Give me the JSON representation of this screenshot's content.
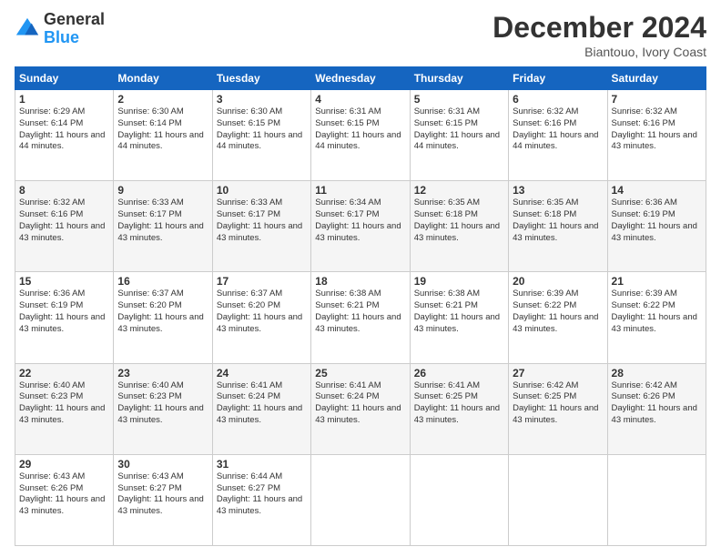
{
  "header": {
    "logo_general": "General",
    "logo_blue": "Blue",
    "title": "December 2024",
    "subtitle": "Biantouo, Ivory Coast"
  },
  "days_of_week": [
    "Sunday",
    "Monday",
    "Tuesday",
    "Wednesday",
    "Thursday",
    "Friday",
    "Saturday"
  ],
  "weeks": [
    [
      {
        "day": "1",
        "sunrise": "6:29 AM",
        "sunset": "6:14 PM",
        "daylight": "11 hours and 44 minutes."
      },
      {
        "day": "2",
        "sunrise": "6:30 AM",
        "sunset": "6:14 PM",
        "daylight": "11 hours and 44 minutes."
      },
      {
        "day": "3",
        "sunrise": "6:30 AM",
        "sunset": "6:15 PM",
        "daylight": "11 hours and 44 minutes."
      },
      {
        "day": "4",
        "sunrise": "6:31 AM",
        "sunset": "6:15 PM",
        "daylight": "11 hours and 44 minutes."
      },
      {
        "day": "5",
        "sunrise": "6:31 AM",
        "sunset": "6:15 PM",
        "daylight": "11 hours and 44 minutes."
      },
      {
        "day": "6",
        "sunrise": "6:32 AM",
        "sunset": "6:16 PM",
        "daylight": "11 hours and 44 minutes."
      },
      {
        "day": "7",
        "sunrise": "6:32 AM",
        "sunset": "6:16 PM",
        "daylight": "11 hours and 43 minutes."
      }
    ],
    [
      {
        "day": "8",
        "sunrise": "6:32 AM",
        "sunset": "6:16 PM",
        "daylight": "11 hours and 43 minutes."
      },
      {
        "day": "9",
        "sunrise": "6:33 AM",
        "sunset": "6:17 PM",
        "daylight": "11 hours and 43 minutes."
      },
      {
        "day": "10",
        "sunrise": "6:33 AM",
        "sunset": "6:17 PM",
        "daylight": "11 hours and 43 minutes."
      },
      {
        "day": "11",
        "sunrise": "6:34 AM",
        "sunset": "6:17 PM",
        "daylight": "11 hours and 43 minutes."
      },
      {
        "day": "12",
        "sunrise": "6:35 AM",
        "sunset": "6:18 PM",
        "daylight": "11 hours and 43 minutes."
      },
      {
        "day": "13",
        "sunrise": "6:35 AM",
        "sunset": "6:18 PM",
        "daylight": "11 hours and 43 minutes."
      },
      {
        "day": "14",
        "sunrise": "6:36 AM",
        "sunset": "6:19 PM",
        "daylight": "11 hours and 43 minutes."
      }
    ],
    [
      {
        "day": "15",
        "sunrise": "6:36 AM",
        "sunset": "6:19 PM",
        "daylight": "11 hours and 43 minutes."
      },
      {
        "day": "16",
        "sunrise": "6:37 AM",
        "sunset": "6:20 PM",
        "daylight": "11 hours and 43 minutes."
      },
      {
        "day": "17",
        "sunrise": "6:37 AM",
        "sunset": "6:20 PM",
        "daylight": "11 hours and 43 minutes."
      },
      {
        "day": "18",
        "sunrise": "6:38 AM",
        "sunset": "6:21 PM",
        "daylight": "11 hours and 43 minutes."
      },
      {
        "day": "19",
        "sunrise": "6:38 AM",
        "sunset": "6:21 PM",
        "daylight": "11 hours and 43 minutes."
      },
      {
        "day": "20",
        "sunrise": "6:39 AM",
        "sunset": "6:22 PM",
        "daylight": "11 hours and 43 minutes."
      },
      {
        "day": "21",
        "sunrise": "6:39 AM",
        "sunset": "6:22 PM",
        "daylight": "11 hours and 43 minutes."
      }
    ],
    [
      {
        "day": "22",
        "sunrise": "6:40 AM",
        "sunset": "6:23 PM",
        "daylight": "11 hours and 43 minutes."
      },
      {
        "day": "23",
        "sunrise": "6:40 AM",
        "sunset": "6:23 PM",
        "daylight": "11 hours and 43 minutes."
      },
      {
        "day": "24",
        "sunrise": "6:41 AM",
        "sunset": "6:24 PM",
        "daylight": "11 hours and 43 minutes."
      },
      {
        "day": "25",
        "sunrise": "6:41 AM",
        "sunset": "6:24 PM",
        "daylight": "11 hours and 43 minutes."
      },
      {
        "day": "26",
        "sunrise": "6:41 AM",
        "sunset": "6:25 PM",
        "daylight": "11 hours and 43 minutes."
      },
      {
        "day": "27",
        "sunrise": "6:42 AM",
        "sunset": "6:25 PM",
        "daylight": "11 hours and 43 minutes."
      },
      {
        "day": "28",
        "sunrise": "6:42 AM",
        "sunset": "6:26 PM",
        "daylight": "11 hours and 43 minutes."
      }
    ],
    [
      {
        "day": "29",
        "sunrise": "6:43 AM",
        "sunset": "6:26 PM",
        "daylight": "11 hours and 43 minutes."
      },
      {
        "day": "30",
        "sunrise": "6:43 AM",
        "sunset": "6:27 PM",
        "daylight": "11 hours and 43 minutes."
      },
      {
        "day": "31",
        "sunrise": "6:44 AM",
        "sunset": "6:27 PM",
        "daylight": "11 hours and 43 minutes."
      },
      null,
      null,
      null,
      null
    ]
  ]
}
